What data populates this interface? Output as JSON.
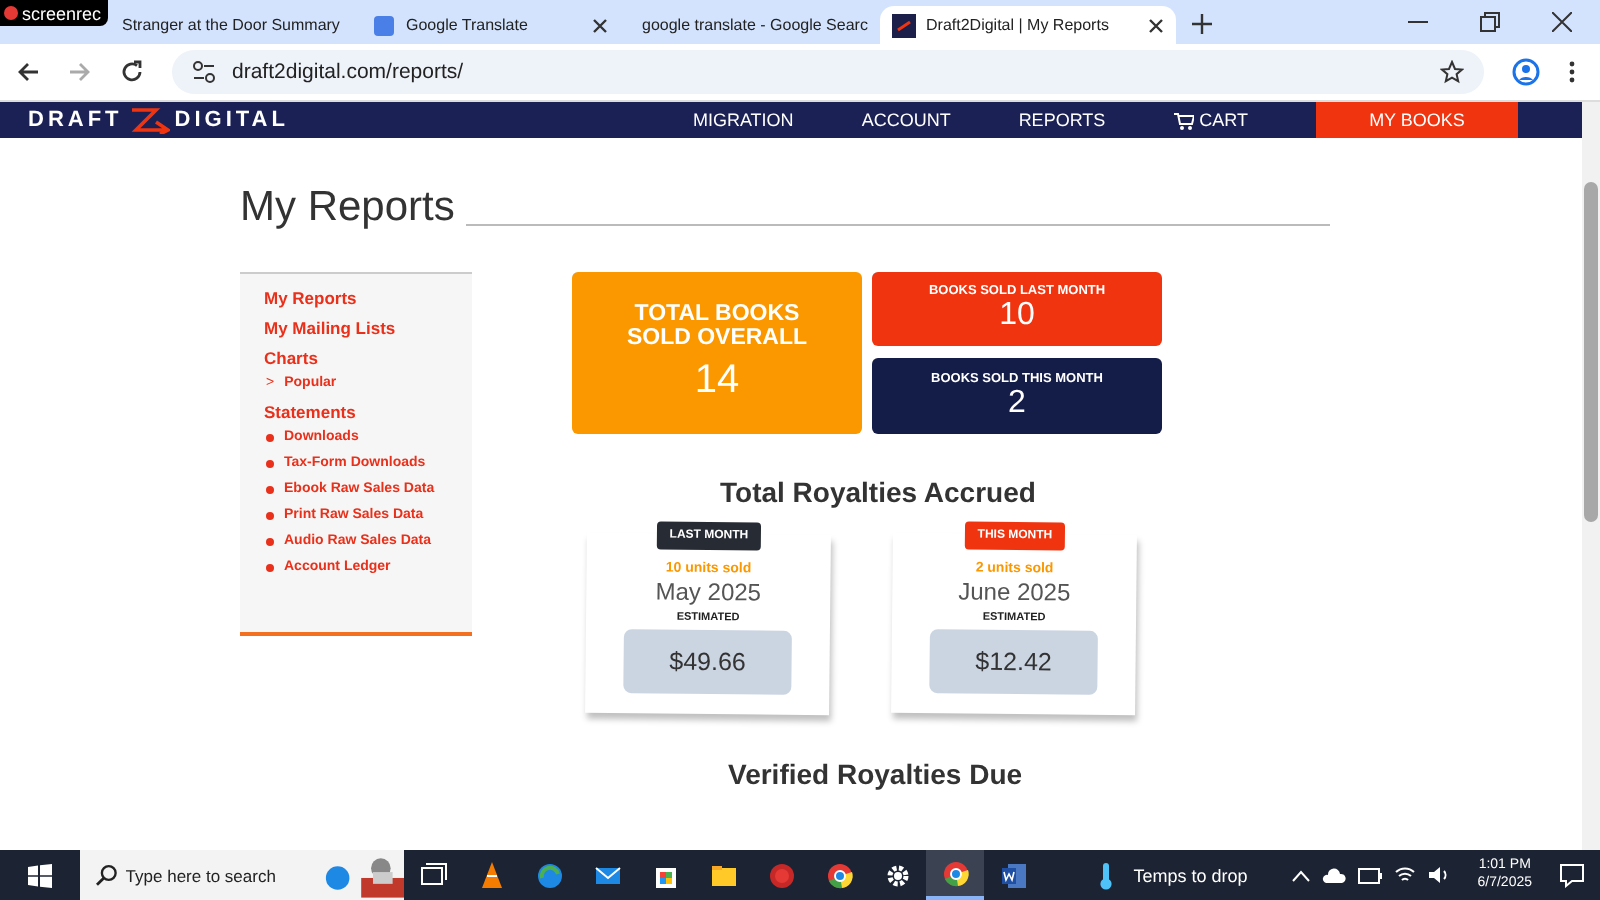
{
  "recorder_badge": "screenrec",
  "tabs": [
    {
      "title": "Stranger at the Door Summary",
      "selected": false
    },
    {
      "title": "Google Translate",
      "selected": false
    },
    {
      "title": "google translate - Google Searc",
      "selected": false
    },
    {
      "title": "Draft2Digital | My Reports",
      "selected": true
    }
  ],
  "address_bar": {
    "url": "draft2digital.com/reports/"
  },
  "site_header": {
    "logo_left": "DRAFT",
    "logo_right": "DIGITAL",
    "nav": [
      "MIGRATION",
      "ACCOUNT",
      "REPORTS",
      "CART"
    ],
    "button": "MY BOOKS"
  },
  "page_title": "My Reports",
  "sidebar": {
    "items": [
      {
        "label": "My Reports"
      },
      {
        "label": "My Mailing Lists"
      },
      {
        "label": "Charts",
        "children": [
          {
            "kind": "arrow",
            "marker": ">",
            "label": "Popular"
          }
        ]
      },
      {
        "label": "Statements",
        "children": [
          {
            "kind": "bullet",
            "label": "Downloads"
          },
          {
            "kind": "bullet",
            "label": "Tax-Form Downloads"
          },
          {
            "kind": "bullet",
            "label": "Ebook Raw Sales Data"
          },
          {
            "kind": "bullet",
            "label": "Print Raw Sales Data"
          },
          {
            "kind": "bullet",
            "label": "Audio Raw Sales Data"
          },
          {
            "kind": "bullet",
            "label": "Account Ledger"
          }
        ]
      }
    ]
  },
  "stats": [
    {
      "label": "TOTAL BOOKS SOLD OVERALL",
      "value": "14",
      "color": "#fb9800"
    },
    {
      "label": "BOOKS SOLD LAST MONTH",
      "value": "10",
      "color": "#f0340f"
    },
    {
      "label": "BOOKS SOLD THIS MONTH",
      "value": "2",
      "color": "#141c48"
    }
  ],
  "royalties": {
    "heading": "Total Royalties Accrued",
    "cards": [
      {
        "tag": "LAST MONTH",
        "color": "#272b33",
        "units": "10 units sold",
        "month": "May 2025",
        "estimate_label": "ESTIMATED",
        "amount": "$49.66"
      },
      {
        "tag": "THIS MONTH",
        "color": "#f0340f",
        "units": "2 units sold",
        "month": "June 2025",
        "estimate_label": "ESTIMATED",
        "amount": "$12.42"
      }
    ]
  },
  "verified_heading": "Verified Royalties Due",
  "taskbar": {
    "search_placeholder": "Type here to search",
    "apps": [
      {
        "selected": false
      },
      {
        "selected": false
      },
      {
        "selected": false
      },
      {
        "selected": false
      },
      {
        "selected": false
      },
      {
        "selected": false
      },
      {
        "selected": false
      },
      {
        "selected": false
      },
      {
        "selected": false
      },
      {
        "selected": true
      },
      {
        "selected": false
      }
    ],
    "weather": "Temps to drop",
    "time": "1:01 PM",
    "date": "6/7/2025"
  }
}
